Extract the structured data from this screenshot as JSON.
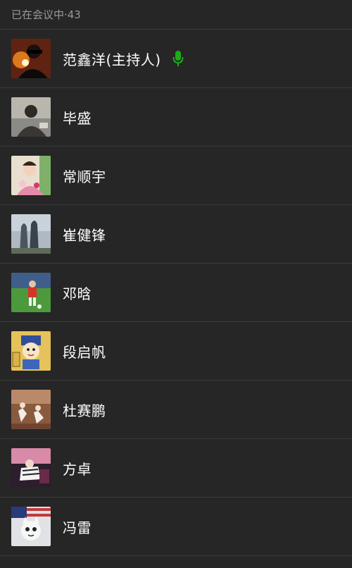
{
  "header": {
    "title": "已在会议中·43"
  },
  "colors": {
    "background": "#262626",
    "divider": "#3a3a3a",
    "header_text": "#9a9a9a",
    "name_text": "#ffffff",
    "mic_active": "#1aad19"
  },
  "participants": [
    {
      "name": "范鑫洋(主持人)",
      "mic": "mic-active-icon",
      "avatar_style": "dark-portrait-orange"
    },
    {
      "name": "毕盛",
      "avatar_style": "gray-portrait"
    },
    {
      "name": "常顺宇",
      "avatar_style": "pink-costume"
    },
    {
      "name": "崔健锋",
      "avatar_style": "city-towers"
    },
    {
      "name": "邓晗",
      "avatar_style": "football-pitch"
    },
    {
      "name": "段启帆",
      "avatar_style": "cartoon-yellow"
    },
    {
      "name": "杜赛鹏",
      "avatar_style": "brown-dancers"
    },
    {
      "name": "方卓",
      "avatar_style": "pink-night-scene"
    },
    {
      "name": "冯雷",
      "avatar_style": "white-cat-flag"
    }
  ]
}
